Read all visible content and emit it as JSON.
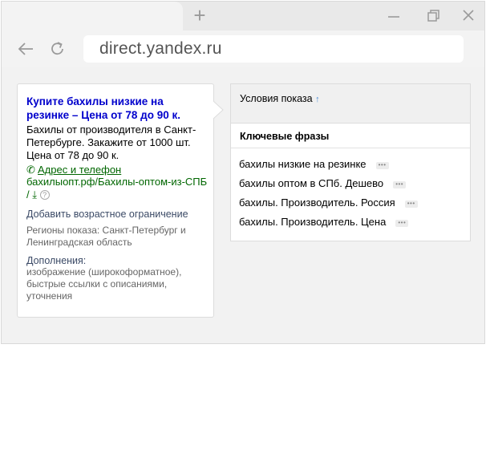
{
  "browser": {
    "url": "direct.yandex.ru",
    "new_tab_glyph": "+",
    "icons": [
      "back-arrow-icon",
      "reload-icon",
      "minimize-icon",
      "restore-icon",
      "close-icon"
    ]
  },
  "ad": {
    "title": "Купите бахилы низкие на резинке – Цена от 78 до 90 к.",
    "text": "Бахилы от производителя в Санкт-Петербурге. Закажите от 1000 шт. Цена от 78 до 90 к.",
    "contact_link": "Адрес и телефон",
    "display_url": "бахилыопт.рф/Бахилы-оптом-из-СПБ /",
    "help_glyph": "?",
    "age_restriction_link": "Добавить возрастное ограничение",
    "regions": "Регионы показа: Санкт-Петербург и Ленинградская область",
    "extras_label": "Дополнения:",
    "extras": "изображение (широкоформатное), быстрые ссылки с описаниями, уточнения"
  },
  "conditions": {
    "title": "Условия показа",
    "sort_glyph": "↑",
    "keywords_header": "Ключевые фразы",
    "more_glyph": "•••",
    "keywords": [
      "бахилы низкие на резинке",
      "бахилы оптом в СПб. Дешево",
      "бахилы. Производитель. Россия",
      "бахилы. Производитель. Цена"
    ]
  },
  "colors": {
    "ad_title": "#0000cc",
    "ad_url": "#006600",
    "link_secondary": "#3b4a66"
  }
}
